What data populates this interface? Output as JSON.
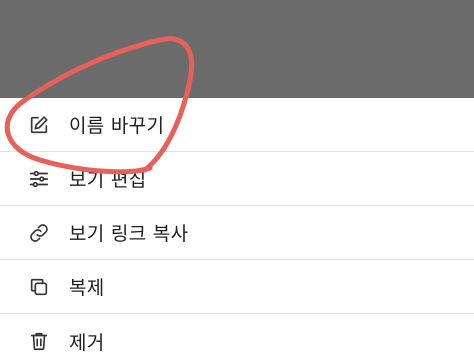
{
  "menu": {
    "items": [
      {
        "label": "이름 바꾸기",
        "icon": "edit-icon"
      },
      {
        "label": "보기 편집",
        "icon": "sliders-icon"
      },
      {
        "label": "보기 링크 복사",
        "icon": "link-icon"
      },
      {
        "label": "복제",
        "icon": "copy-icon"
      },
      {
        "label": "제거",
        "icon": "trash-icon"
      }
    ]
  },
  "colors": {
    "overlay": "#6b6b6b",
    "annotation": "#e8605a",
    "divider": "#e3e3e3",
    "text": "#1f1f1f"
  }
}
